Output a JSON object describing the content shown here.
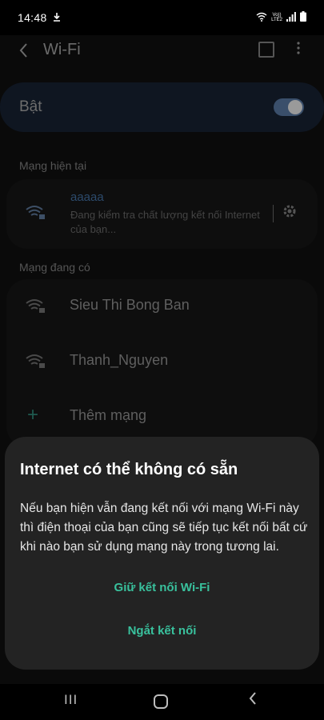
{
  "status_bar": {
    "time": "14:48",
    "download_icon": "download-icon",
    "volte_top": "Vo))",
    "volte_bottom": "LTE2",
    "wifi_icon": "wifi-status-icon",
    "signal_icon": "signal-icon",
    "battery_icon": "battery-icon"
  },
  "app_bar": {
    "back_icon": "back-arrow-icon",
    "title": "Wi-Fi",
    "qr_icon": "qr-scan-icon",
    "more_icon": "more-vert-icon"
  },
  "toggle": {
    "label": "Bật",
    "state": "on"
  },
  "current_section": {
    "header": "Mạng hiện tại",
    "ssid": "aaaaa",
    "status": "Đang kiểm tra chất lượng kết nối Internet của bạn..."
  },
  "available_section": {
    "header": "Mạng đang có",
    "networks": [
      {
        "name": "Sieu Thi Bong Ban"
      },
      {
        "name": "Thanh_Nguyen"
      }
    ],
    "add_label": "Thêm mạng"
  },
  "dialog": {
    "title": "Internet có thể không có sẵn",
    "body": "Nếu bạn hiện vẫn đang kết nối với mạng Wi-Fi này thì điện thoại của bạn cũng sẽ tiếp tục kết nối bất cứ khi nào bạn sử dụng mạng này trong tương lai.",
    "keep_button": "Giữ kết nối Wi-Fi",
    "disconnect_button": "Ngắt kết nối"
  },
  "nav_bar": {
    "recent_glyph": "III",
    "back_glyph": "<"
  },
  "colors": {
    "accent": "#39c19d",
    "dialog_bg": "#232323",
    "background": "#000000"
  }
}
